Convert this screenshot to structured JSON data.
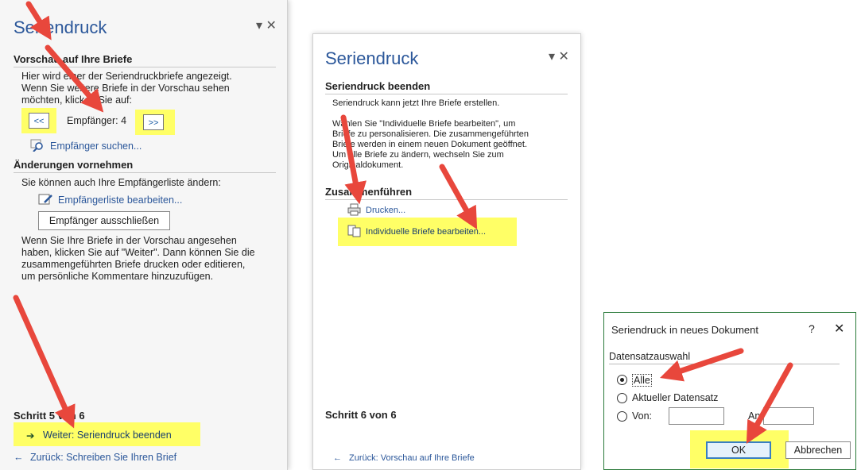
{
  "pane1": {
    "title": "Seriendruck",
    "close": "▾ ✕",
    "sec1_head": "Vorschau auf Ihre Briefe",
    "sec1_text": [
      "Hier wird einer der Seriendruckbriefe angezeigt.",
      "Wenn Sie weitere Briefe in der Vorschau sehen",
      "möchten, klicken Sie auf:"
    ],
    "prev_btn": "<<",
    "recipient_label": "Empfänger: 4",
    "next_btn": ">>",
    "find_recipient": "Empfänger suchen...",
    "sec2_head": "Änderungen vornehmen",
    "sec2_text": "Sie können auch Ihre Empfängerliste ändern:",
    "edit_list": "Empfängerliste bearbeiten...",
    "exclude_btn": "Empfänger ausschließen",
    "info_text": [
      "Wenn Sie Ihre Briefe in der Vorschau angesehen",
      "haben, klicken Sie auf \"Weiter\". Dann können Sie die",
      "zusammengeführten Briefe drucken oder editieren,",
      "um persönliche Kommentare hinzuzufügen."
    ],
    "step": "Schritt 5 von 6",
    "next_link": "Weiter: Seriendruck beenden",
    "back_link": "Zurück: Schreiben Sie Ihren Brief"
  },
  "pane2": {
    "title": "Seriendruck",
    "close": "▾ ✕",
    "sec1_head": "Seriendruck beenden",
    "sec1_text": "Seriendruck kann jetzt Ihre Briefe erstellen.",
    "sec1_para": [
      "Wählen Sie \"Individuelle Briefe bearbeiten\", um",
      "Briefe zu personalisieren. Die zusammengeführten",
      "Briefe werden in einem neuen Dokument geöffnet.",
      "Um alle Briefe zu ändern, wechseln Sie zum",
      "Originaldokument."
    ],
    "sec2_head": "Zusammenführen",
    "print_link": "Drucken...",
    "edit_link": "Individuelle Briefe bearbeiten...",
    "step": "Schritt 6 von 6",
    "back_link": "Zurück: Vorschau auf Ihre Briefe"
  },
  "dialog": {
    "title": "Seriendruck in neues Dokument",
    "help": "?",
    "close": "✕",
    "group": "Datensatzauswahl",
    "opt_all": "Alle",
    "opt_current": "Aktueller Datensatz",
    "opt_from": "Von:",
    "to_label": "An:",
    "from_value": "",
    "to_value": "",
    "ok": "OK",
    "cancel": "Abbrechen"
  },
  "colors": {
    "accent": "#2b579a",
    "highlight": "#ffff66",
    "arrow": "#e8473c",
    "green_arrow": "#2e8b3a"
  }
}
